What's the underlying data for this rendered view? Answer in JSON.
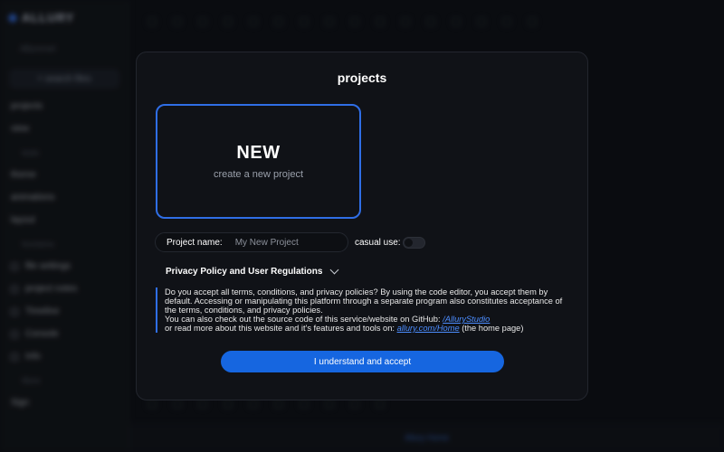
{
  "background": {
    "brand": "ALLURY",
    "sidebar_label": "Allurenet",
    "search_label": "+ search files",
    "items_top": [
      "projects",
      "view"
    ],
    "section_tools": "tools",
    "items_mid": [
      "theme",
      "animations",
      "layout"
    ],
    "section_functions": "functions",
    "items_icon": [
      "file settings",
      "project notes"
    ],
    "items_lower": [
      "Timeline",
      "Console",
      "Info"
    ],
    "section_more": "More",
    "bottom_item": "Sign",
    "footer_link": "Allury Home"
  },
  "modal": {
    "title": "projects",
    "new_card": {
      "title": "NEW",
      "subtitle": "create a new project"
    },
    "project_name": {
      "label": "Project name:",
      "value": "",
      "placeholder": "My New Project"
    },
    "casual": {
      "label": "casual use:",
      "enabled": false
    },
    "privacy": {
      "title": "Privacy Policy and User Regulations",
      "paragraph1": "Do you accept all terms, conditions, and privacy policies? By using the code editor, you accept them by default. Accessing or manipulating this platform through a separate program also constitutes acceptance of the terms, conditions, and privacy policies.",
      "github_prefix": "You can also check out the source code of this service/website on GitHub: ",
      "github_link": "/AlluryStudio",
      "home_prefix": "or read more about this website and it's features and tools on: ",
      "home_link": "allury.com/Home",
      "home_suffix": " (the home page)"
    },
    "accept_label": "I understand and accept"
  },
  "colors": {
    "accent": "#2f6ee6",
    "button": "#1666e0",
    "modal_bg": "#101217",
    "link": "#4c8dff"
  }
}
